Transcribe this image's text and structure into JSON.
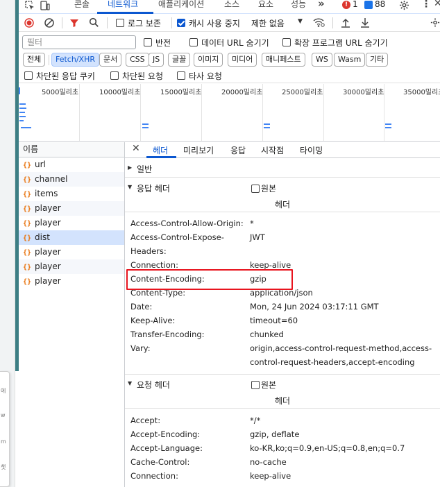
{
  "tabs": [
    "콘솔",
    "네트워크",
    "애플리케이션",
    "소스",
    "요소",
    "성능"
  ],
  "tabbar": {
    "errors": "1",
    "warnings": "88",
    "more": "»"
  },
  "toolbar": {
    "preserve_log": "로그 보존",
    "disable_cache": "캐시 사용 중지",
    "throttle": "제한 없음"
  },
  "filter": {
    "placeholder": "필터",
    "invert": "반전",
    "hide_data_urls": "데이터 URL 숨기기",
    "hide_ext_urls": "확장 프로그램 URL 숨기기"
  },
  "chips": [
    "전체",
    "Fetch/XHR",
    "문서",
    "CSS",
    "JS",
    "글꼴",
    "이미지",
    "미디어",
    "매니페스트",
    "WS",
    "Wasm",
    "기타"
  ],
  "blocked": {
    "blocked_cookies": "차단된 응답 쿠키",
    "blocked_requests": "차단된 요청",
    "third_party": "타사 요청"
  },
  "overview": {
    "ticks": [
      "5000밀리초",
      "10000밀리초",
      "15000밀리초",
      "20000밀리초",
      "25000밀리초",
      "30000밀리초",
      "35000밀리초"
    ]
  },
  "requests": {
    "header": "이름",
    "items": [
      "url",
      "channel",
      "items",
      "player",
      "player",
      "dist",
      "player",
      "player",
      "player"
    ]
  },
  "details": {
    "tabs": [
      "헤더",
      "미리보기",
      "응답",
      "시작점",
      "타이밍"
    ],
    "general": "일반",
    "response_headers": "응답 헤더",
    "request_headers": "요청 헤더",
    "raw": "원본",
    "sub_header": "헤더",
    "response": [
      {
        "k": "Access-Control-Allow-Origin:",
        "v": "*"
      },
      {
        "k": "Access-Control-Expose-Headers:",
        "v": "JWT"
      },
      {
        "k": "Connection:",
        "v": "keep-alive"
      },
      {
        "k": "Content-Encoding:",
        "v": "gzip"
      },
      {
        "k": "Content-Type:",
        "v": "application/json"
      },
      {
        "k": "Date:",
        "v": "Mon, 24 Jun 2024 03:17:11 GMT"
      },
      {
        "k": "Keep-Alive:",
        "v": "timeout=60"
      },
      {
        "k": "Transfer-Encoding:",
        "v": "chunked"
      },
      {
        "k": "Vary:",
        "v": "origin,access-control-request-method,access-control-request-headers,accept-encoding"
      }
    ],
    "request": [
      {
        "k": "Accept:",
        "v": "*/*"
      },
      {
        "k": "Accept-Encoding:",
        "v": "gzip, deflate"
      },
      {
        "k": "Accept-Language:",
        "v": "ko-KR,ko;q=0.9,en-US;q=0.8,en;q=0.7"
      },
      {
        "k": "Cache-Control:",
        "v": "no-cache"
      },
      {
        "k": "Connection:",
        "v": "keep-alive"
      }
    ]
  }
}
